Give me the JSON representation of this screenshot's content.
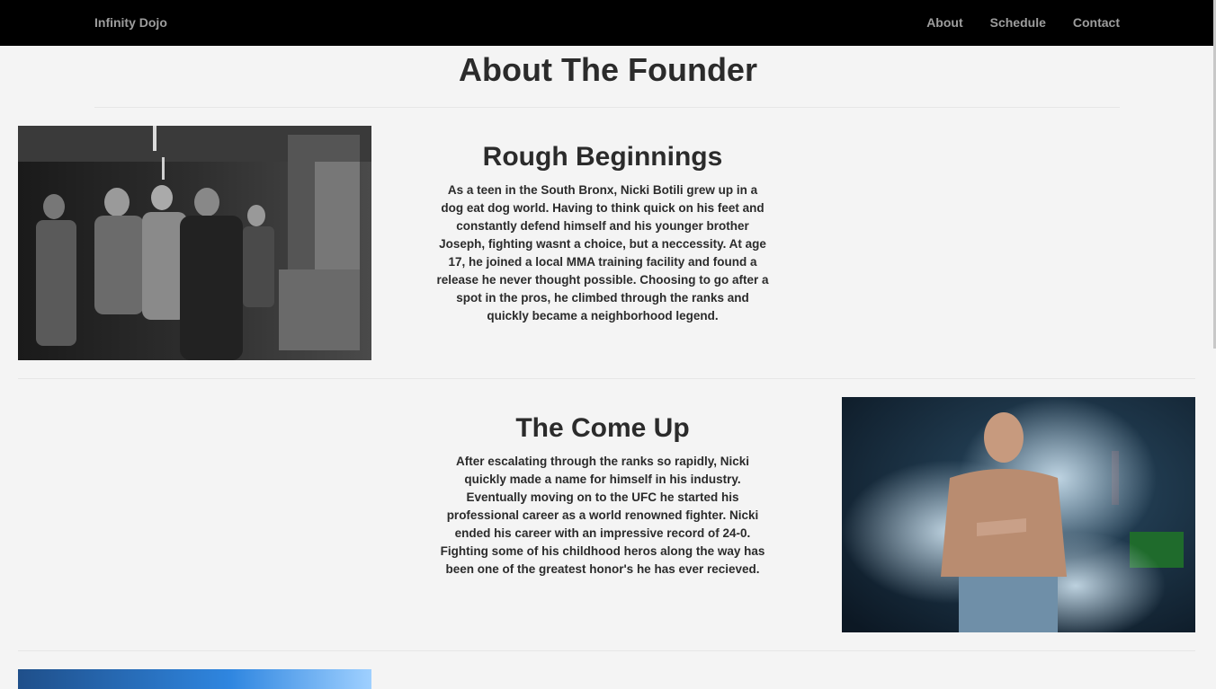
{
  "nav": {
    "brand": "Infinity Dojo",
    "links": [
      "About",
      "Schedule",
      "Contact"
    ]
  },
  "page_title": "About The Founder",
  "sections": [
    {
      "heading": "Rough Beginnings",
      "body": "As a teen in the South Bronx, Nicki Botili grew up in a dog eat dog world. Having to think quick on his feet and constantly defend himself and his younger brother Joseph, fighting wasnt a choice, but a neccessity. At age 17, he joined a local MMA training facility and found a release he never thought possible. Choosing to go after a spot in the pros, he climbed through the ranks and quickly became a neighborhood legend."
    },
    {
      "heading": "The Come Up",
      "body": "After escalating through the ranks so rapidly, Nicki quickly made a name for himself in his industry. Eventually moving on to the UFC he started his professional career as a world renowned fighter. Nicki ended his career with an impressive record of 24-0. Fighting some of his childhood heros along the way has been one of the greatest honor's he has ever recieved."
    }
  ],
  "colors": {
    "navbar_bg": "#000000",
    "nav_text": "#9d9d9d",
    "page_bg": "#f4f4f4",
    "text": "#2b2b2b"
  }
}
